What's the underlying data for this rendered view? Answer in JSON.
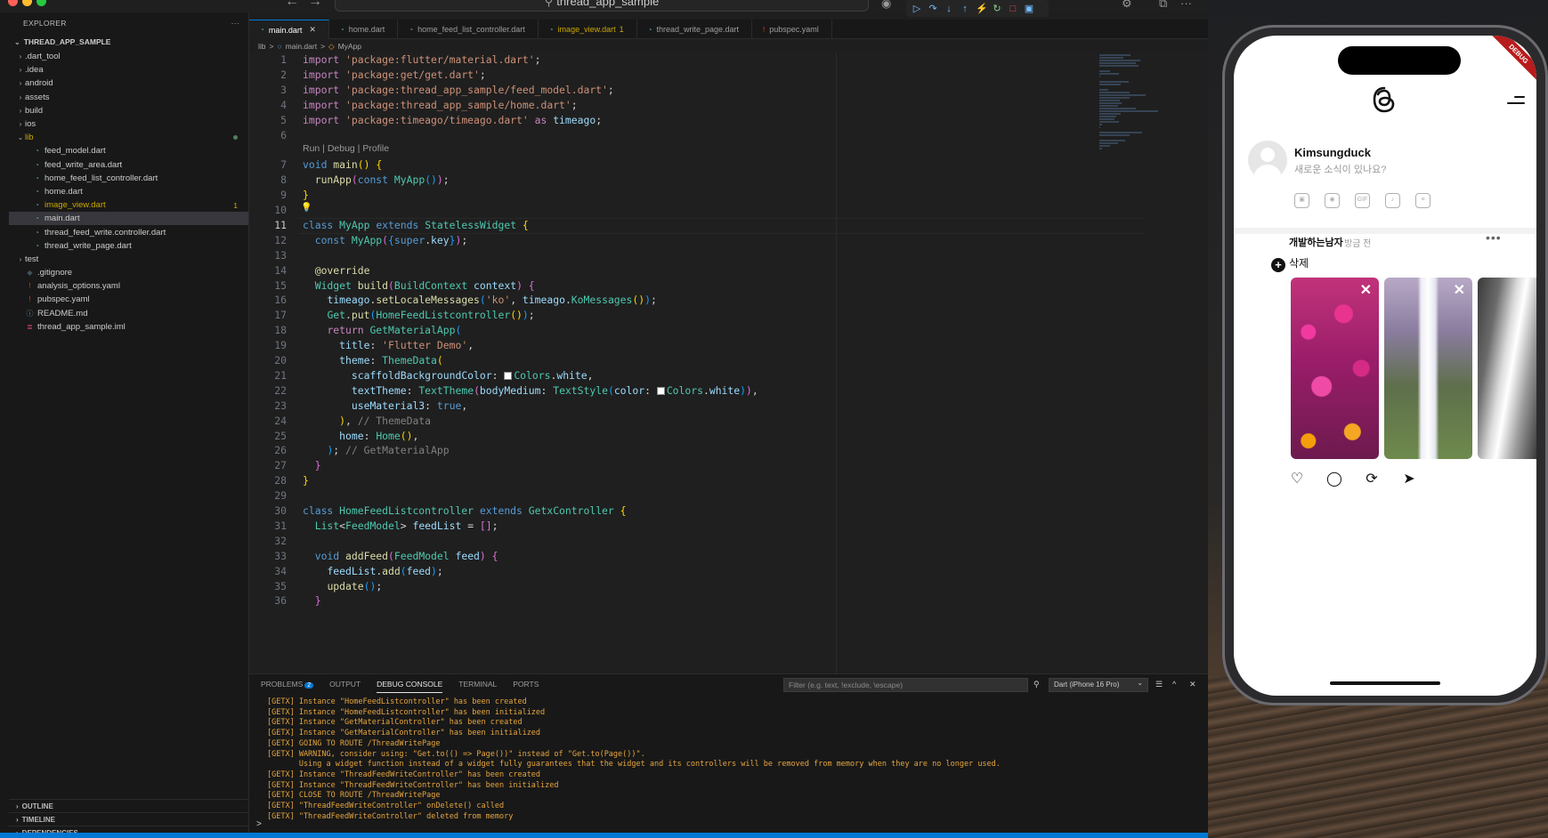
{
  "window": {
    "title": "thread_app_sample"
  },
  "titlebar": {
    "back": "←",
    "forward": "→",
    "layout_icon": "⧉",
    "more": "···"
  },
  "debug_toolbar": {
    "buttons": [
      "continue",
      "step-over",
      "step-into",
      "step-out",
      "hot-reload",
      "restart",
      "stop",
      "devtools"
    ]
  },
  "sidebar": {
    "header": "EXPLORER",
    "more": "···",
    "project": "THREAD_APP_SAMPLE",
    "items": [
      {
        "label": ".dart_tool",
        "kind": "folder",
        "level": 1
      },
      {
        "label": ".idea",
        "kind": "folder",
        "level": 1
      },
      {
        "label": "android",
        "kind": "folder",
        "level": 1
      },
      {
        "label": "assets",
        "kind": "folder",
        "level": 1
      },
      {
        "label": "build",
        "kind": "folder",
        "level": 1
      },
      {
        "label": "ios",
        "kind": "folder",
        "level": 1
      },
      {
        "label": "lib",
        "kind": "folder-open",
        "level": 1,
        "color": "#cca700"
      },
      {
        "label": "feed_model.dart",
        "kind": "dart",
        "level": 2
      },
      {
        "label": "feed_write_area.dart",
        "kind": "dart",
        "level": 2
      },
      {
        "label": "home_feed_list_controller.dart",
        "kind": "dart",
        "level": 2
      },
      {
        "label": "home.dart",
        "kind": "dart",
        "level": 2
      },
      {
        "label": "image_view.dart",
        "kind": "dart",
        "level": 2,
        "color": "#cca700",
        "badge": "1"
      },
      {
        "label": "main.dart",
        "kind": "dart",
        "level": 2,
        "selected": true
      },
      {
        "label": "thread_feed_write.controller.dart",
        "kind": "dart",
        "level": 2
      },
      {
        "label": "thread_write_page.dart",
        "kind": "dart",
        "level": 2
      },
      {
        "label": "test",
        "kind": "folder",
        "level": 1
      },
      {
        "label": ".gitignore",
        "kind": "git",
        "level": 1
      },
      {
        "label": "analysis_options.yaml",
        "kind": "yaml",
        "level": 1
      },
      {
        "label": "pubspec.yaml",
        "kind": "yaml",
        "level": 1
      },
      {
        "label": "README.md",
        "kind": "info",
        "level": 1
      },
      {
        "label": "thread_app_sample.iml",
        "kind": "iml",
        "level": 1
      }
    ],
    "bottom": [
      "OUTLINE",
      "TIMELINE",
      "DEPENDENCIES"
    ]
  },
  "tabs": [
    {
      "label": "main.dart",
      "active": true,
      "close": "✕"
    },
    {
      "label": "home.dart"
    },
    {
      "label": "home_feed_list_controller.dart"
    },
    {
      "label": "image_view.dart",
      "warn": true,
      "count": "1"
    },
    {
      "label": "thread_write_page.dart"
    },
    {
      "label": "pubspec.yaml",
      "yaml": true
    }
  ],
  "breadcrumb": [
    "lib",
    ">",
    "main.dart",
    ">",
    "MyApp"
  ],
  "editor": {
    "codelens": "Run | Debug | Profile",
    "current_line": 11,
    "lines": [
      {
        "n": 1,
        "html": "<span class='c'>import</span> <span class='s'>'package:flutter/material.dart'</span><span class='w'>;</span>"
      },
      {
        "n": 2,
        "html": "<span class='c'>import</span> <span class='s'>'package:get/get.dart'</span><span class='w'>;</span>"
      },
      {
        "n": 3,
        "html": "<span class='c'>import</span> <span class='s'>'package:thread_app_sample/feed_model.dart'</span><span class='w'>;</span>"
      },
      {
        "n": 4,
        "html": "<span class='c'>import</span> <span class='s'>'package:thread_app_sample/home.dart'</span><span class='w'>;</span>"
      },
      {
        "n": 5,
        "html": "<span class='c'>import</span> <span class='s'>'package:timeago/timeago.dart'</span> <span class='c'>as</span> <span class='v'>timeago</span><span class='w'>;</span>"
      },
      {
        "n": 6,
        "html": ""
      },
      {
        "n": 7,
        "html": "<span class='k'>void</span> <span class='f'>main</span><span class='p'>()</span> <span class='p'>{</span>",
        "codelens": true
      },
      {
        "n": 8,
        "html": "  <span class='f'>runApp</span><span class='p2'>(</span><span class='k'>const</span> <span class='t'>MyApp</span><span class='p3'>()</span><span class='p2'>)</span><span class='w'>;</span>"
      },
      {
        "n": 9,
        "html": "<span class='p'>}</span>"
      },
      {
        "n": 10,
        "html": "",
        "bulb": true
      },
      {
        "n": 11,
        "html": "<span class='k'>class</span> <span class='t'>MyApp</span> <span class='k'>extends</span> <span class='t'>StatelessWidget</span> <span class='p'>{</span>"
      },
      {
        "n": 12,
        "html": "  <span class='k'>const</span> <span class='t'>MyApp</span><span class='p2'>(</span><span class='p3'>{</span><span class='k'>super</span><span class='w'>.</span><span class='v'>key</span><span class='p3'>}</span><span class='p2'>)</span><span class='w'>;</span>"
      },
      {
        "n": 13,
        "html": ""
      },
      {
        "n": 14,
        "html": "  <span class='f'>@override</span>"
      },
      {
        "n": 15,
        "html": "  <span class='t'>Widget</span> <span class='f'>build</span><span class='p2'>(</span><span class='t'>BuildContext</span> <span class='v'>context</span><span class='p2'>)</span> <span class='p2'>{</span>"
      },
      {
        "n": 16,
        "html": "    <span class='v'>timeago</span><span class='w'>.</span><span class='f'>setLocaleMessages</span><span class='p3'>(</span><span class='s'>'ko'</span><span class='w'>, </span><span class='v'>timeago</span><span class='w'>.</span><span class='t'>KoMessages</span><span class='p'>()</span><span class='p3'>)</span><span class='w'>;</span>"
      },
      {
        "n": 17,
        "html": "    <span class='t'>Get</span><span class='w'>.</span><span class='f'>put</span><span class='p3'>(</span><span class='t'>HomeFeedListcontroller</span><span class='p'>()</span><span class='p3'>)</span><span class='w'>;</span>"
      },
      {
        "n": 18,
        "html": "    <span class='c'>return</span> <span class='t'>GetMaterialApp</span><span class='p3'>(</span>"
      },
      {
        "n": 19,
        "html": "      <span class='v'>title</span><span class='w'>: </span><span class='s'>'Flutter Demo'</span><span class='w'>,</span>"
      },
      {
        "n": 20,
        "html": "      <span class='v'>theme</span><span class='w'>: </span><span class='t'>ThemeData</span><span class='p'>(</span>"
      },
      {
        "n": 21,
        "html": "        <span class='v'>scaffoldBackgroundColor</span><span class='w'>: </span><span class='swatch'></span><span class='t'>Colors</span><span class='w'>.</span><span class='v'>white</span><span class='w'>,</span>"
      },
      {
        "n": 22,
        "html": "        <span class='v'>textTheme</span><span class='w'>: </span><span class='t'>TextTheme</span><span class='p2'>(</span><span class='v'>bodyMedium</span><span class='w'>: </span><span class='t'>TextStyle</span><span class='p3'>(</span><span class='v'>color</span><span class='w'>: </span><span class='swatch'></span><span class='t'>Colors</span><span class='w'>.</span><span class='v'>white</span><span class='p3'>)</span><span class='p2'>)</span><span class='w'>,</span>"
      },
      {
        "n": 23,
        "html": "        <span class='v'>useMaterial3</span><span class='w'>: </span><span class='k'>true</span><span class='w'>,</span>"
      },
      {
        "n": 24,
        "html": "      <span class='p'>)</span><span class='w'>, </span><span class='gray'>// ThemeData</span>"
      },
      {
        "n": 25,
        "html": "      <span class='v'>home</span><span class='w'>: </span><span class='t'>Home</span><span class='p'>()</span><span class='w'>,</span>"
      },
      {
        "n": 26,
        "html": "    <span class='p3'>)</span><span class='w'>; </span><span class='gray'>// GetMaterialApp</span>"
      },
      {
        "n": 27,
        "html": "  <span class='p2'>}</span>"
      },
      {
        "n": 28,
        "html": "<span class='p'>}</span>"
      },
      {
        "n": 29,
        "html": ""
      },
      {
        "n": 30,
        "html": "<span class='k'>class</span> <span class='t'>HomeFeedListcontroller</span> <span class='k'>extends</span> <span class='t'>GetxController</span> <span class='p'>{</span>"
      },
      {
        "n": 31,
        "html": "  <span class='t'>List</span><span class='w'>&lt;</span><span class='t'>FeedModel</span><span class='w'>&gt;</span> <span class='v'>feedList</span> <span class='w'>=</span> <span class='p2'>[]</span><span class='w'>;</span>"
      },
      {
        "n": 32,
        "html": ""
      },
      {
        "n": 33,
        "html": "  <span class='k'>void</span> <span class='f'>addFeed</span><span class='p2'>(</span><span class='t'>FeedModel</span> <span class='v'>feed</span><span class='p2'>)</span> <span class='p2'>{</span>"
      },
      {
        "n": 34,
        "html": "    <span class='v'>feedList</span><span class='w'>.</span><span class='f'>add</span><span class='p3'>(</span><span class='v'>feed</span><span class='p3'>)</span><span class='w'>;</span>"
      },
      {
        "n": 35,
        "html": "    <span class='f'>update</span><span class='p3'>()</span><span class='w'>;</span>"
      },
      {
        "n": 36,
        "html": "  <span class='p2'>}</span>"
      }
    ]
  },
  "panel": {
    "tabs": [
      {
        "label": "PROBLEMS",
        "badge": "2"
      },
      {
        "label": "OUTPUT"
      },
      {
        "label": "DEBUG CONSOLE",
        "active": true
      },
      {
        "label": "TERMINAL"
      },
      {
        "label": "PORTS"
      }
    ],
    "filter_placeholder": "Filter (e.g. text, !exclude, \\escape)",
    "device": "Dart (iPhone 16 Pro)",
    "device_chevron": "⌄",
    "filter_icon": "⚲",
    "list_icon": "☰",
    "maximize_icon": "^",
    "close_icon": "✕",
    "log": [
      "[GETX] Instance \"HomeFeedListcontroller\" has been created",
      "[GETX] Instance \"HomeFeedListcontroller\" has been initialized",
      "[GETX] Instance \"GetMaterialController\" has been created",
      "[GETX] Instance \"GetMaterialController\" has been initialized",
      "[GETX] GOING TO ROUTE /ThreadWritePage",
      "[GETX] WARNING, consider using: \"Get.to(() => Page())\" instead of \"Get.to(Page())\".",
      "       Using a widget function instead of a widget fully guarantees that the widget and its controllers will be removed from memory when they are no longer used.",
      "[GETX] Instance \"ThreadFeedWriteController\" has been created",
      "[GETX] Instance \"ThreadFeedWriteController\" has been initialized",
      "[GETX] CLOSE TO ROUTE /ThreadWritePage",
      "[GETX] \"ThreadFeedWriteController\" onDelete() called",
      "[GETX] \"ThreadFeedWriteController\" deleted from memory"
    ],
    "prompt": ">"
  },
  "phone": {
    "debug_banner": "DEBUG",
    "user": {
      "name": "Kimsungduck",
      "placeholder": "새로운 소식이 있나요?"
    },
    "compose_icons": [
      "gallery-icon",
      "camera-icon",
      "gif-icon",
      "mic-icon",
      "list-icon"
    ],
    "post": {
      "author": "개발하는남자",
      "time": "방금 전",
      "more": "•••",
      "delete_label": "삭제",
      "plus": "+",
      "close": "✕"
    },
    "actions": [
      {
        "name": "heart-icon",
        "glyph": "♡"
      },
      {
        "name": "comment-icon",
        "glyph": "◯"
      },
      {
        "name": "repost-icon",
        "glyph": "⟳"
      },
      {
        "name": "share-icon",
        "glyph": "➤"
      }
    ]
  },
  "colors": {
    "accent": "#0078d4",
    "warning": "#cca700",
    "console": "#e5a53f",
    "debug_banner": "#b71c1c"
  }
}
